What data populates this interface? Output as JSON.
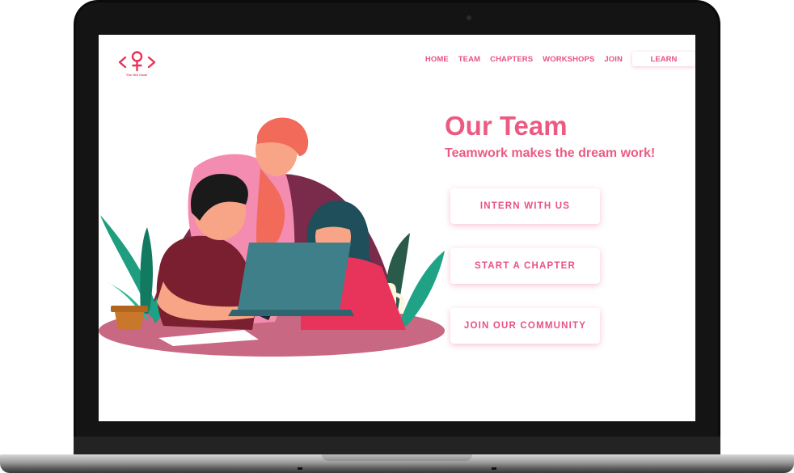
{
  "brand": {
    "logo_text": "The Girl Code",
    "accent": "#e85281"
  },
  "nav": {
    "items": [
      "HOME",
      "TEAM",
      "CHAPTERS",
      "WORKSHOPS",
      "JOIN"
    ],
    "learn_label": "LEARN"
  },
  "hero": {
    "title": "Our Team",
    "subtitle": "Teamwork makes the dream work!"
  },
  "cta": {
    "intern": "INTERN WITH US",
    "chapter": "START A CHAPTER",
    "community": "JOIN OUR COMMUNITY"
  }
}
